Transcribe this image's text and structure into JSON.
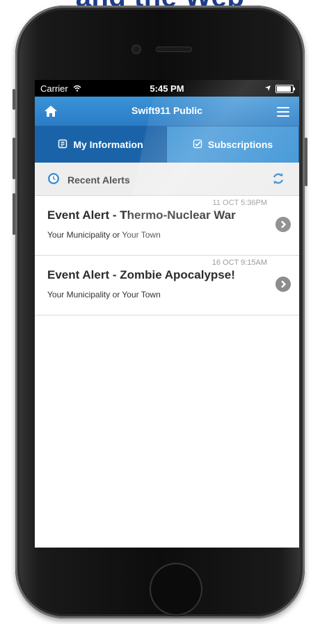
{
  "headline": "and the Web",
  "status": {
    "carrier": "Carrier",
    "time": "5:45 PM"
  },
  "nav": {
    "title": "Swift911 Public"
  },
  "tabs": [
    {
      "label": "My Information"
    },
    {
      "label": "Subscriptions"
    }
  ],
  "section": {
    "label": "Recent Alerts"
  },
  "alerts": [
    {
      "date": "11 OCT 5:36PM",
      "title": "Event Alert - Thermo-Nuclear War",
      "subtitle": "Your Municipality or Your Town"
    },
    {
      "date": "16 OCT 9:15AM",
      "title": "Event Alert - Zombie Apocalypse!",
      "subtitle": "Your Municipality or Your Town"
    }
  ],
  "colors": {
    "nav_blue": "#2a7cc5",
    "tab_blue": "#1f6fb8",
    "headline": "#1f3d8a"
  }
}
